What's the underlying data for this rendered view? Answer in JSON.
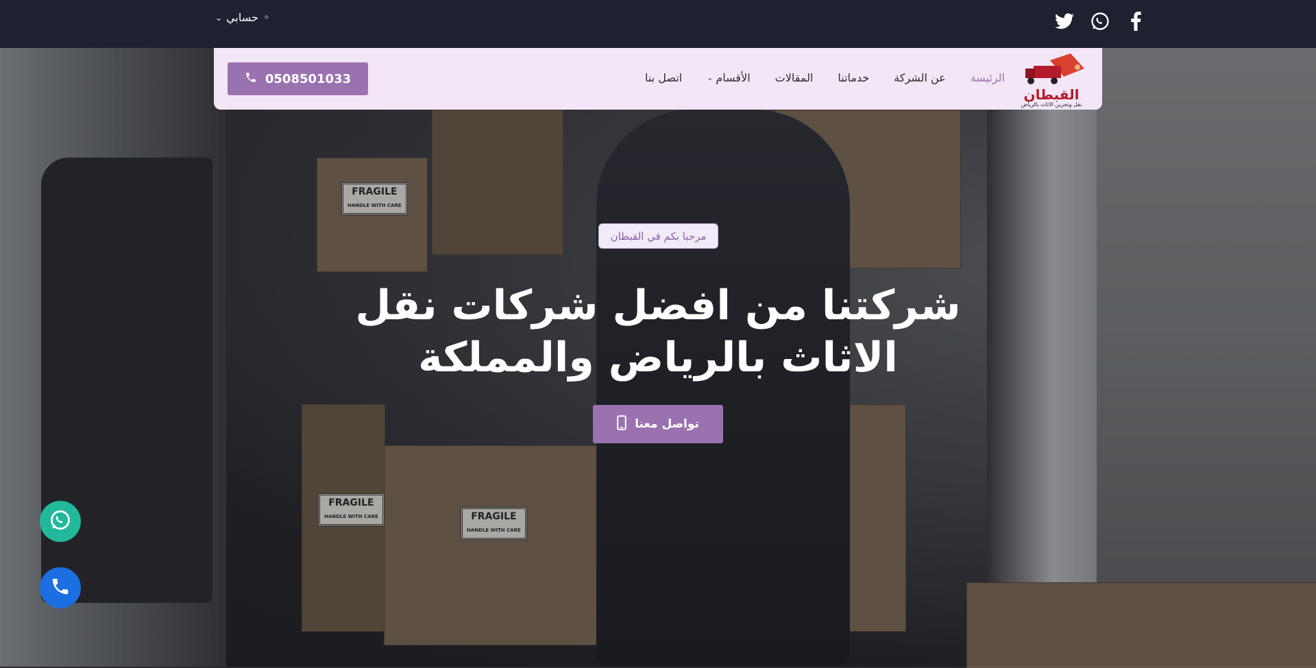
{
  "topbar": {
    "account_label": "حسابي",
    "social": [
      "facebook-icon",
      "whatsapp-icon",
      "twitter-icon"
    ]
  },
  "nav": {
    "logo_text": "القبطان",
    "logo_sub": "نقل وتخزين الاثاث بالرياض",
    "items": [
      {
        "label": "الرئيسة",
        "active": true
      },
      {
        "label": "عن الشركة"
      },
      {
        "label": "خدماتنا"
      },
      {
        "label": "المقالات"
      },
      {
        "label": "الأقسام",
        "dropdown": true
      },
      {
        "label": "اتصل بنا"
      }
    ],
    "phone_label": "0508501033"
  },
  "hero": {
    "badge": "مرحبا بكم في القبطان",
    "title_line1": "شركتنا من افضل شركات نقل",
    "title_line2": "الاثاث بالرياض والمملكة",
    "cta_label": "تواصل معنا",
    "fragile_label": "FRAGILE",
    "fragile_sub": "HANDLE WITH CARE"
  },
  "colors": {
    "accent": "#9b72b0",
    "topbar": "#1e2130",
    "navbar": "#f3e6f7",
    "whatsapp": "#22b89b",
    "call": "#1c6fe0"
  }
}
